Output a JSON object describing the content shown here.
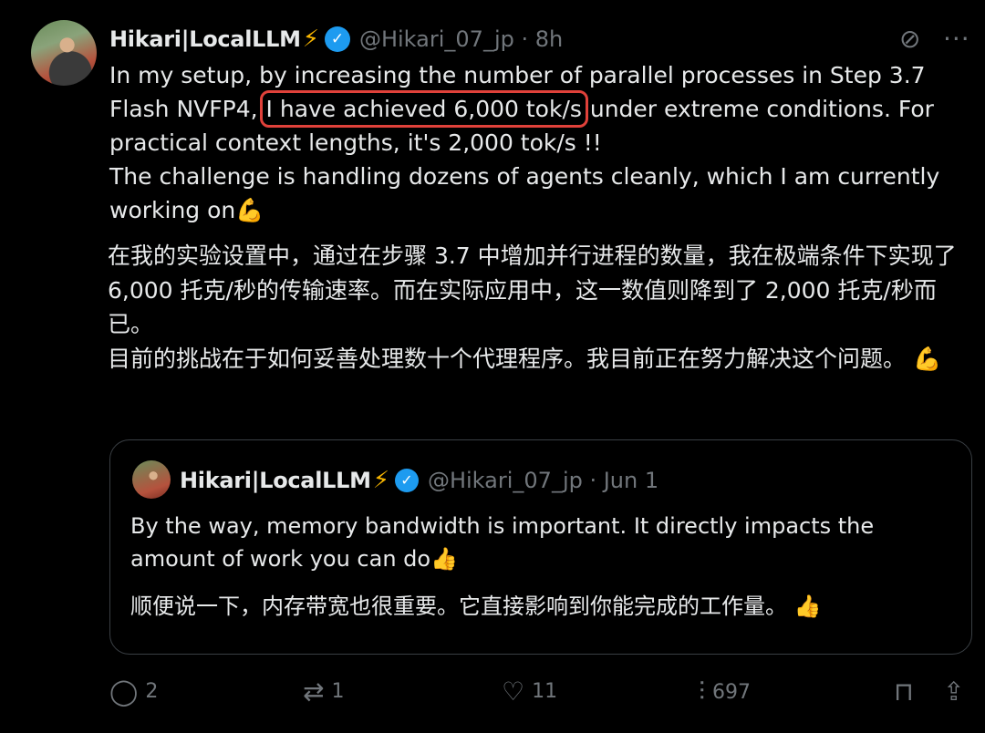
{
  "tweet": {
    "author_name": "Hikari|LocalLLM",
    "name_emoji": "⚡",
    "verified_mark": "✓",
    "handle_time": "@Hikari_07_jp · 8h",
    "text_en_before": "In my setup, by increasing the number of parallel processes in Step 3.7 Flash NVFP4, ",
    "text_en_highlight": "I have achieved 6,000 tok/s",
    "text_en_after": " under extreme conditions. For practical context lengths, it's 2,000 tok/s !!",
    "text_en_line2": "The challenge is handling dozens of agents cleanly, which I am currently working on💪",
    "text_zh": "在我的实验设置中，通过在步骤 3.7 中增加并行进程的数量，我在极端条件下实现了 6,000 托克/秒的传输速率。而在实际应用中，这一数值则降到了 2,000 托克/秒而已。",
    "text_zh_line2": "目前的挑战在于如何妥善处理数十个代理程序。我目前正在努力解决这个问题。 💪",
    "icons": {
      "grok": "⊘",
      "more": "···"
    }
  },
  "quoted": {
    "author_name": "Hikari|LocalLLM",
    "name_emoji": "⚡",
    "verified_mark": "✓",
    "handle_date": "@Hikari_07_jp · Jun 1",
    "text_en": "By the way, memory bandwidth is important. It directly impacts the amount of work you can do👍",
    "text_zh": "顺便说一下，内存带宽也很重要。它直接影响到你能完成的工作量。 👍"
  },
  "actions": {
    "reply": {
      "icon": "reply-icon",
      "glyph": "◯",
      "count": "2"
    },
    "repost": {
      "icon": "repost-icon",
      "glyph": "⇄",
      "count": "1"
    },
    "like": {
      "icon": "heart-icon",
      "glyph": "♡",
      "count": "11"
    },
    "views": {
      "icon": "views-icon",
      "glyph": "⫶",
      "count": "697"
    },
    "bookmark": {
      "icon": "bookmark-icon",
      "glyph": "⊓"
    },
    "share": {
      "icon": "share-icon",
      "glyph": "⇪"
    }
  },
  "colors": {
    "background": "#000000",
    "text": "#e7e9ea",
    "muted": "#71767b",
    "verified": "#1d9bf0",
    "highlight_box": "#e0413a",
    "bolt": "#f7b500"
  }
}
